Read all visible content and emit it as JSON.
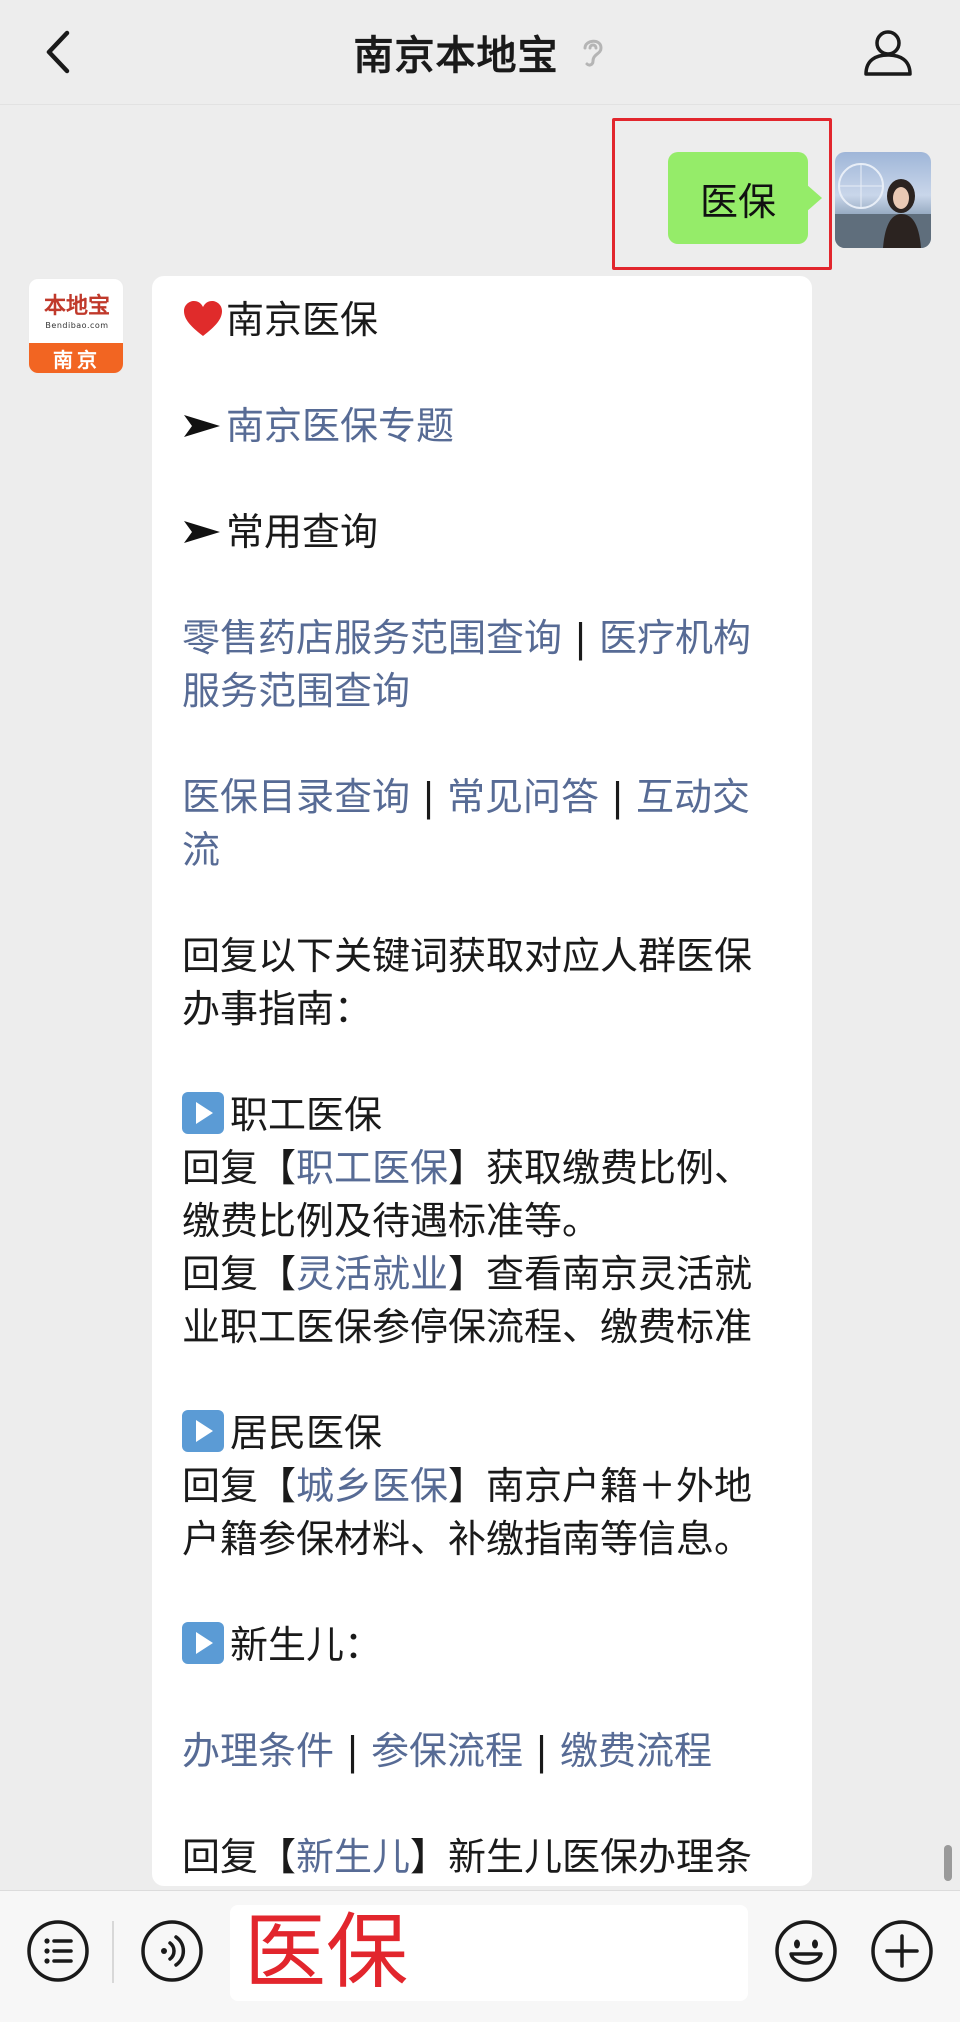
{
  "header": {
    "title": "南京本地宝",
    "back_icon": "chevron-left-icon",
    "ear_icon": "ear-icon",
    "profile_icon": "person-icon"
  },
  "outgoing": {
    "text": "医保",
    "bubble_color": "#95ec69",
    "highlight_color": "#e2262d"
  },
  "bot_avatar": {
    "logo_text": "本地宝",
    "logo_sub": "Bendibao.com",
    "city": "南京"
  },
  "reply": {
    "heading": "南京医保",
    "topic_link": "南京医保专题",
    "common_query": "常用查询",
    "query_links_row1a": "零售药店服务范围查询",
    "query_links_row1b": "医疗机构",
    "query_links_row1c": "服务范围查询",
    "query_links_row2a": "医保目录查询",
    "query_links_row2b": "常见问答",
    "query_links_row2c": "互动交",
    "query_links_row2d": "流",
    "separator": " | ",
    "intro_1": "回复以下关键词获取对应人群医保",
    "intro_2": "办事指南：",
    "section_worker_title": "职工医保",
    "reply_prefix": "回复【",
    "reply_suffix_open": "】",
    "worker_kw": "职工医保",
    "worker_desc_1": "获取缴费比例、",
    "worker_desc_2": "缴费比例及待遇标准等。",
    "flex_kw": "灵活就业",
    "flex_desc_1": "查看南京灵活就",
    "flex_desc_2": "业职工医保参停保流程、缴费标准",
    "section_resident_title": "居民医保",
    "resident_kw": "城乡医保",
    "resident_desc_1": "南京户籍＋外地",
    "resident_desc_2": "户籍参保材料、补缴指南等信息。",
    "section_newborn_title": "新生儿：",
    "newborn_link_1": "办理条件",
    "newborn_link_2": "参保流程",
    "newborn_link_3": "缴费流程",
    "newborn_kw": "新生儿",
    "newborn_desc": "新生儿医保办理条",
    "link_color": "#576b95"
  },
  "input": {
    "value": "医保",
    "menu_icon": "list-menu-icon",
    "voice_icon": "voice-icon",
    "emoji_icon": "smiley-icon",
    "plus_icon": "plus-circle-icon"
  }
}
